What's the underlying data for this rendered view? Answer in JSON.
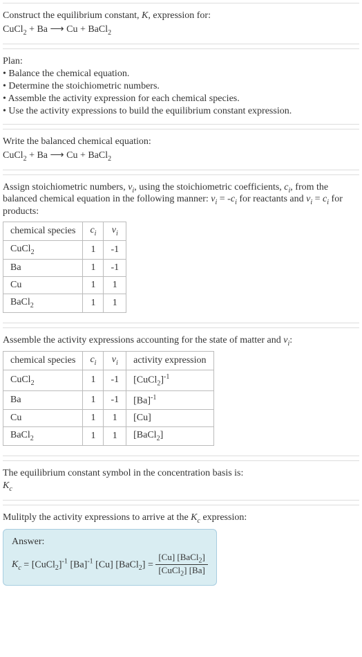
{
  "header_prompt": "Construct the equilibrium constant, K, expression for:",
  "reaction_display": "CuCl₂ + Ba ⟶ Cu + BaCl₂",
  "plan_title": "Plan:",
  "plan_items": [
    "• Balance the chemical equation.",
    "• Determine the stoichiometric numbers.",
    "• Assemble the activity expression for each chemical species.",
    "• Use the activity expressions to build the equilibrium constant expression."
  ],
  "balanced_intro": "Write the balanced chemical equation:",
  "balanced_reaction": "CuCl₂ + Ba ⟶ Cu + BaCl₂",
  "stoich_intro_1": "Assign stoichiometric numbers, νᵢ, using the stoichiometric coefficients, cᵢ, from the balanced chemical equation in the following manner: νᵢ = -cᵢ for reactants and νᵢ = cᵢ for products:",
  "table1": {
    "headers": [
      "chemical species",
      "cᵢ",
      "νᵢ"
    ],
    "rows": [
      [
        "CuCl₂",
        "1",
        "-1"
      ],
      [
        "Ba",
        "1",
        "-1"
      ],
      [
        "Cu",
        "1",
        "1"
      ],
      [
        "BaCl₂",
        "1",
        "1"
      ]
    ]
  },
  "activity_intro": "Assemble the activity expressions accounting for the state of matter and νᵢ:",
  "table2": {
    "headers": [
      "chemical species",
      "cᵢ",
      "νᵢ",
      "activity expression"
    ],
    "rows": [
      [
        "CuCl₂",
        "1",
        "-1",
        "[CuCl₂]⁻¹"
      ],
      [
        "Ba",
        "1",
        "-1",
        "[Ba]⁻¹"
      ],
      [
        "Cu",
        "1",
        "1",
        "[Cu]"
      ],
      [
        "BaCl₂",
        "1",
        "1",
        "[BaCl₂]"
      ]
    ]
  },
  "symbol_intro": "The equilibrium constant symbol in the concentration basis is:",
  "symbol": "K_c",
  "multiply_intro": "Mulitply the activity expressions to arrive at the K_c expression:",
  "answer_label": "Answer:",
  "answer_lhs": "K_c = [CuCl₂]⁻¹ [Ba]⁻¹ [Cu] [BaCl₂] =",
  "answer_frac_num": "[Cu] [BaCl₂]",
  "answer_frac_den": "[CuCl₂] [Ba]"
}
